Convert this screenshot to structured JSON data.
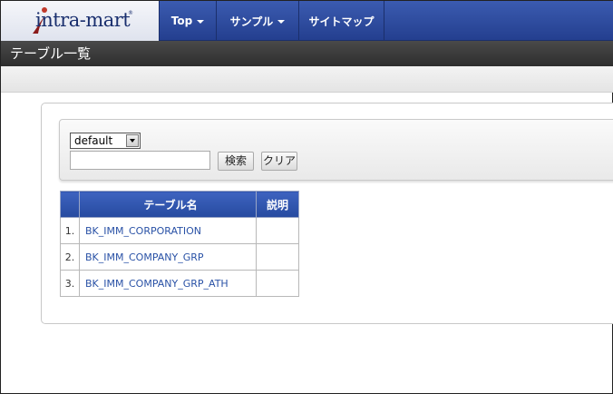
{
  "brand": {
    "logo_text": "intra-mart"
  },
  "nav": {
    "top": "Top",
    "sample": "サンプル",
    "sitemap": "サイトマップ"
  },
  "page": {
    "title": "テーブル一覧"
  },
  "search": {
    "select_value": "default",
    "input_value": "",
    "search_button": "検索",
    "clear_button": "クリア"
  },
  "table": {
    "headers": [
      "",
      "テーブル名",
      "説明"
    ],
    "rows": [
      {
        "num": "1.",
        "name": "BK_IMM_CORPORATION",
        "desc": ""
      },
      {
        "num": "2.",
        "name": "BK_IMM_COMPANY_GRP",
        "desc": ""
      },
      {
        "num": "3.",
        "name": "BK_IMM_COMPANY_GRP_ATH",
        "desc": ""
      }
    ]
  },
  "colors": {
    "nav_bg": "#2f4fa3",
    "title_bg": "#3a3a3a",
    "link": "#2a52a6",
    "table_header": "#2f55b0"
  }
}
